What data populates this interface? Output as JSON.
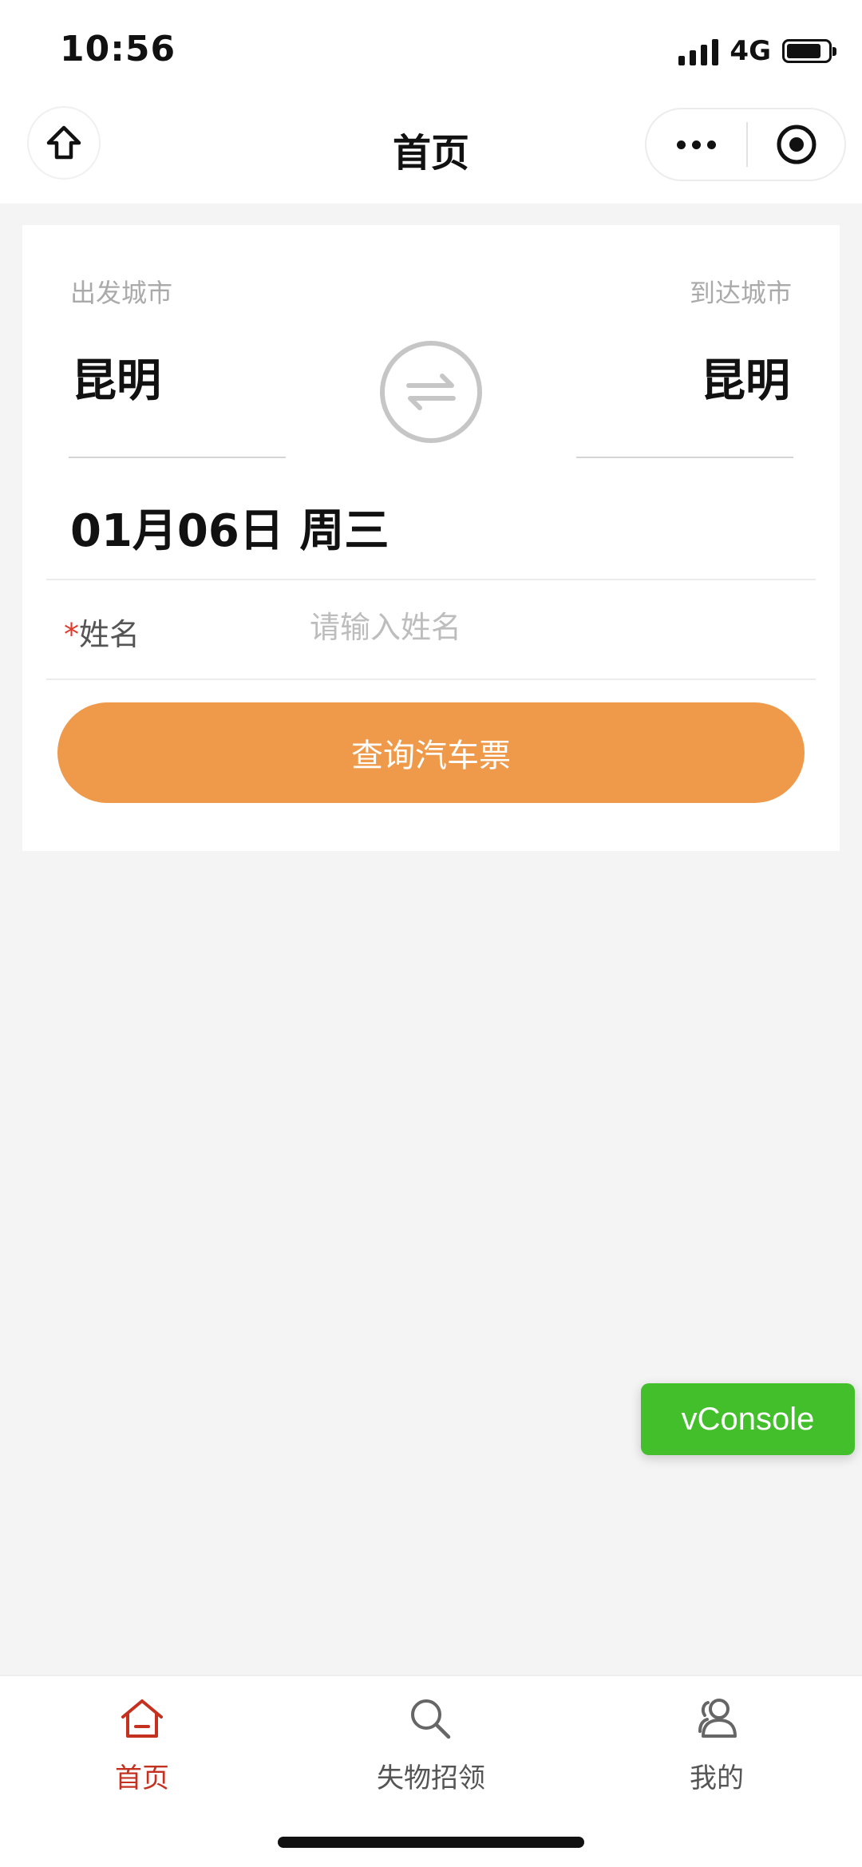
{
  "status_bar": {
    "time": "10:56",
    "network": "4G",
    "battery_level": 0.85
  },
  "nav": {
    "title": "首页",
    "icons": [
      "home-icon",
      "more-icon",
      "close-target-icon"
    ]
  },
  "form": {
    "from_label": "出发城市",
    "from_city": "昆明",
    "to_label": "到达城市",
    "to_city": "昆明",
    "swap_icon": "swap-arrows-icon",
    "date": "01月06日 周三",
    "name_required": "*",
    "name_label": "姓名",
    "name_placeholder": "请输入姓名",
    "name_value": "",
    "submit_label": "查询汽车票"
  },
  "vconsole": {
    "label": "vConsole"
  },
  "tabbar": {
    "items": [
      {
        "label": "首页",
        "icon": "home-icon",
        "active": true
      },
      {
        "label": "失物招领",
        "icon": "search-icon",
        "active": false
      },
      {
        "label": "我的",
        "icon": "user-icon",
        "active": false
      }
    ]
  },
  "colors": {
    "accent_orange": "#ef994a",
    "active_red": "#c5311f",
    "vconsole_green": "#44bf2c",
    "background": "#f4f4f4"
  }
}
